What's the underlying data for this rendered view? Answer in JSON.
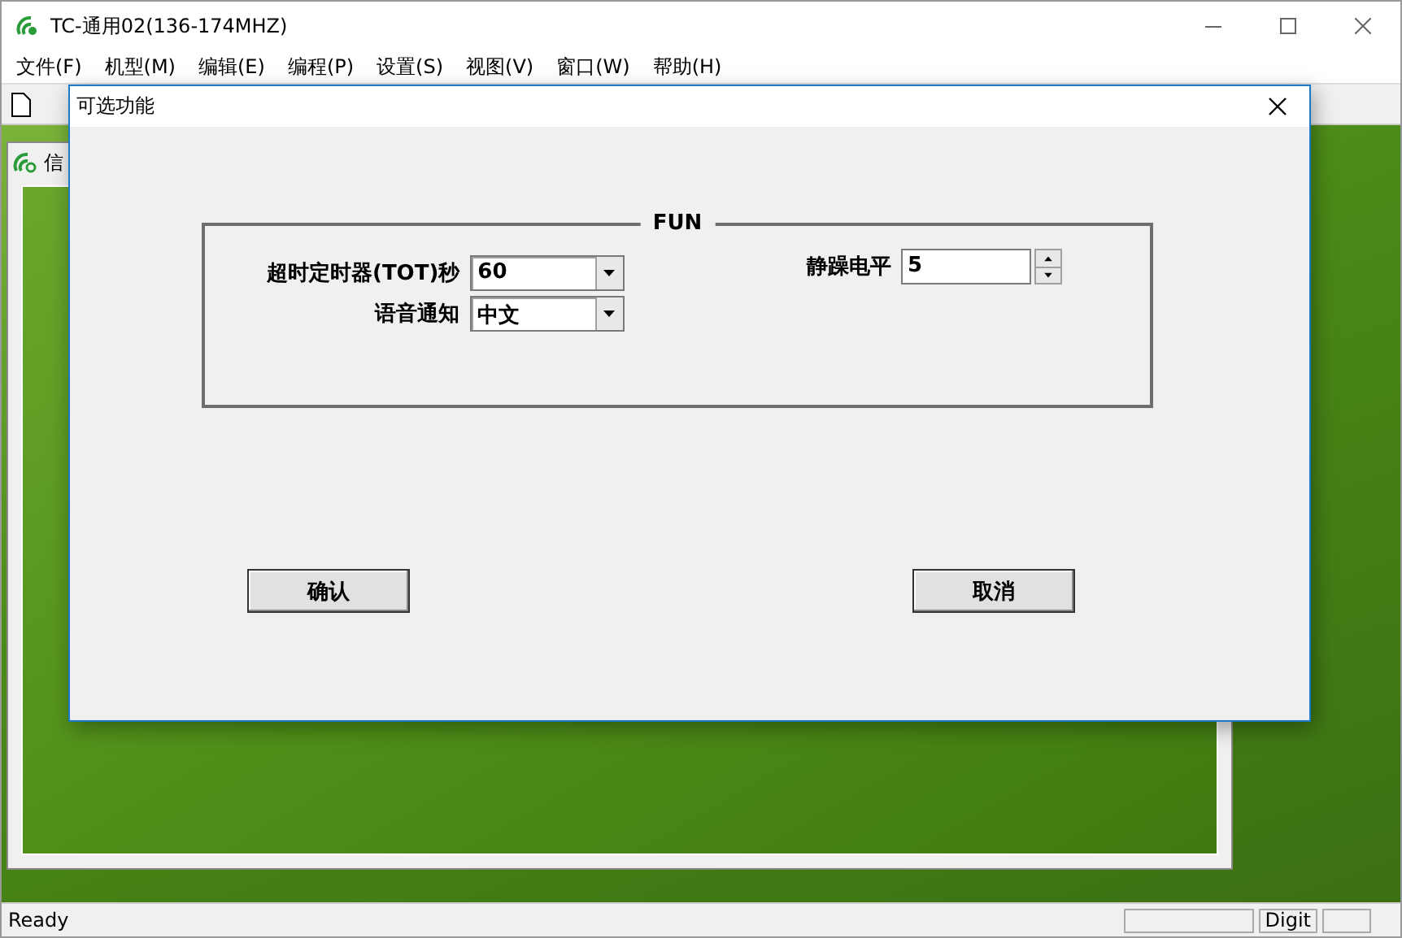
{
  "window": {
    "title": "TC-通用02(136-174MHZ)"
  },
  "menu": [
    "文件(F)",
    "机型(M)",
    "编辑(E)",
    "编程(P)",
    "设置(S)",
    "视图(V)",
    "窗口(W)",
    "帮助(H)"
  ],
  "child_window": {
    "title": "信"
  },
  "dialog": {
    "title": "可选功能",
    "group": {
      "title": "FUN",
      "fields": [
        {
          "kind": "combo",
          "label": "超时定时器(TOT)秒",
          "value": "60"
        },
        {
          "kind": "combo",
          "label": "语音通知",
          "value": "中文"
        },
        {
          "kind": "spin",
          "label": "静躁电平",
          "value": "5"
        }
      ]
    },
    "buttons": [
      {
        "label": "确认"
      },
      {
        "label": "取消"
      }
    ]
  },
  "status_bar": {
    "text": "Ready",
    "indicator": "Digit"
  }
}
